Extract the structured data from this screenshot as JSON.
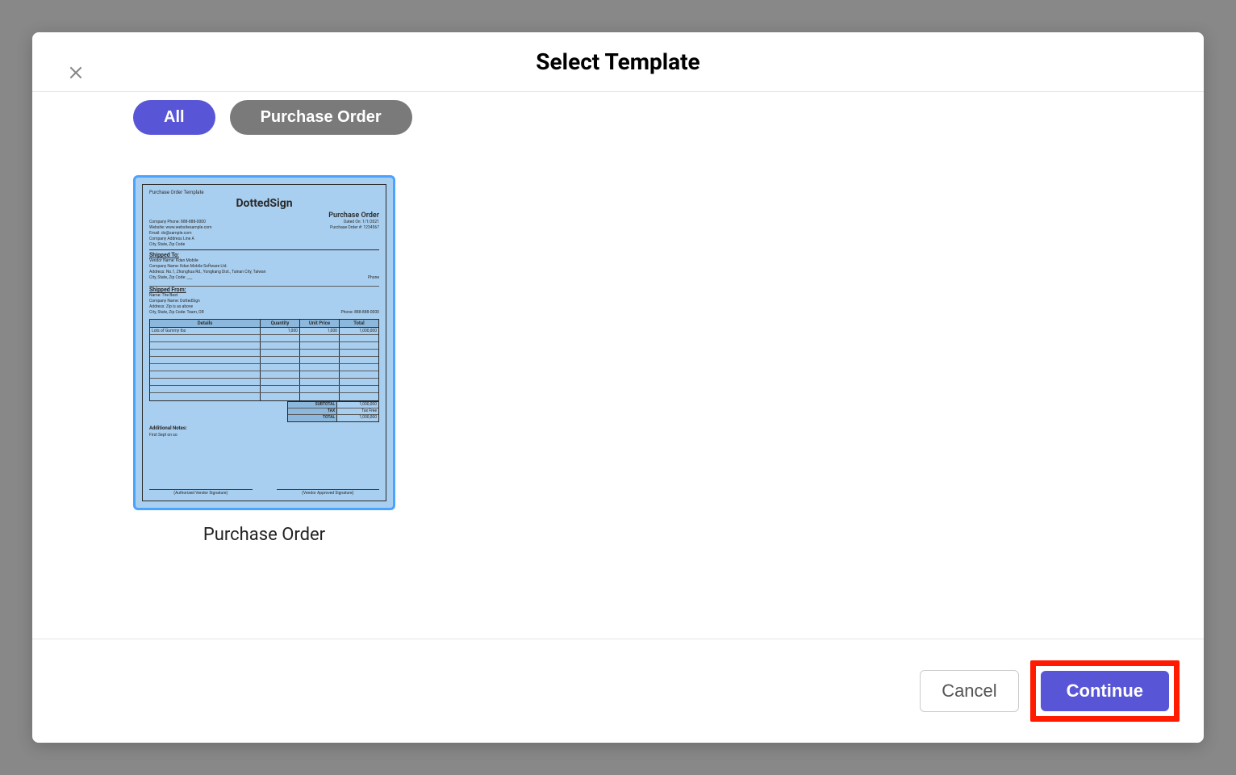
{
  "modal": {
    "title": "Select Template",
    "filters": [
      {
        "label": "All",
        "active": true
      },
      {
        "label": "Purchase Order",
        "active": false
      }
    ],
    "templates": [
      {
        "label": "Purchase Order"
      }
    ],
    "buttons": {
      "cancel": "Cancel",
      "continue": "Continue"
    }
  },
  "preview": {
    "caption": "Purchase Order Template",
    "brand": "DottedSign",
    "doc_title": "Purchase Order",
    "company_lines": [
      "Company Phone: 888-888-0000",
      "Website: www.websitesample.com",
      "Email: do@sample.com",
      "Company Address Line A",
      "City, State, Zip Code"
    ],
    "meta_date": "Dated On: 1/1/2021",
    "meta_po": "Purchase Order #: 1234567",
    "section_shipped_to": "Shipped To:",
    "shipped_to_lines": [
      "Vendor Name: Kdan Mobile",
      "Company Name: Kdan Mobile Software Ltd.",
      "Address: No.1, Zhonghua Rd., Yongkang Dist., Tainan City, Taiwan",
      "City, State, Zip Code: ___"
    ],
    "phone_label": "Phone",
    "section_shipped_from": "Shipped From:",
    "shipped_from_lines": [
      "Name: The Best",
      "Company Name: DottedSign",
      "Address: Zip is as above",
      "City, State, Zip Code: Team, OR"
    ],
    "phone_value": "Phone: 888-888-0000",
    "table_headers": {
      "detail": "Details",
      "qty": "Quantity",
      "price": "Unit Price",
      "total": "Total"
    },
    "table_row": {
      "detail": "Lots of Gummy tbs",
      "qty": "1,000",
      "price": "1,000",
      "total": "1,000,000"
    },
    "summary": {
      "subtotal_label": "SUBTOTAL",
      "subtotal_value": "1,000,000",
      "tax_label": "TAX",
      "tax_value": "Tax Free",
      "total_label": "TOTAL",
      "total_value": "1,000,000"
    },
    "notes_title": "Additional Notes:",
    "notes_body": "First Sept on so",
    "sig_left": "(Authorized Vendor Signature)",
    "sig_right": "(Vendor Approved Signature)"
  }
}
